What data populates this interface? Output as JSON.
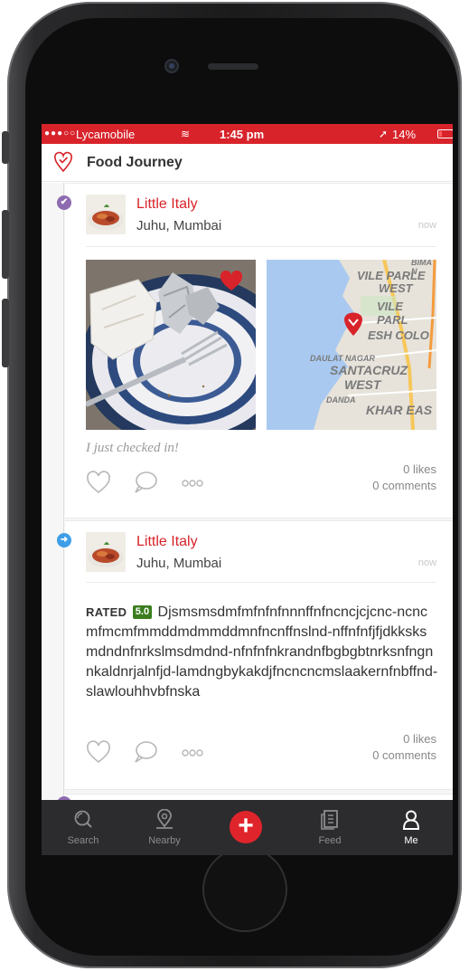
{
  "status_bar": {
    "signal": "●●●○○",
    "carrier": "Lycamobile",
    "wifi": "≋",
    "time": "1:45 pm",
    "location_arrow": "➚",
    "battery": "14%"
  },
  "header": {
    "title": "Food Journey",
    "icon": "heart-pin-icon"
  },
  "feed": [
    {
      "type": "checkin",
      "indicator": "checkin-icon",
      "indicator_color": "#8e6bb0",
      "venue_name": "Little Italy",
      "venue_location": "Juhu, Mumbai",
      "time_ago": "now",
      "caption": "I just checked in!",
      "likes": "0 likes",
      "comments": "0 comments",
      "map_labels": [
        "BIMA N",
        "VILE PARLE",
        "WEST",
        "VILE PARL",
        "ESH COLO",
        "DAULAT NAGAR",
        "SANTACRUZ",
        "WEST",
        "DANDA",
        "KHAR EAS"
      ]
    },
    {
      "type": "review",
      "indicator": "review-icon",
      "indicator_color": "#3f9ee6",
      "venue_name": "Little Italy",
      "venue_location": "Juhu, Mumbai",
      "time_ago": "now",
      "rated_label": "RATED",
      "rating": "5.0",
      "review_text": "Djsmsmsdmfmfnfnfnnnffnfncncjcjcnc-ncncmfmcmfmmddmdmmddmnfncnffnslnd-nffnfnfjfjdkksksmdndnfnrkslmsdmdnd-nfnfnfnkrandnfbgbgbtnrksnfngnnkaldnrjalnfjd-lamdngbykakdjfncncncmslaakernfnbffnd-slawlouhhvbfnska",
      "likes": "0 likes",
      "comments": "0 comments"
    }
  ],
  "tab_bar": {
    "tabs": [
      {
        "label": "Search",
        "icon": "search-icon"
      },
      {
        "label": "Nearby",
        "icon": "location-pin-icon"
      },
      {
        "label": "",
        "icon": "add-icon"
      },
      {
        "label": "Feed",
        "icon": "feed-icon"
      },
      {
        "label": "Me",
        "icon": "user-icon"
      }
    ],
    "active": "Me",
    "add_symbol": "+"
  },
  "colors": {
    "brand_red": "#d8232a",
    "rating_green": "#3b7d1e",
    "tab_bar_bg": "#2c2c2e"
  }
}
